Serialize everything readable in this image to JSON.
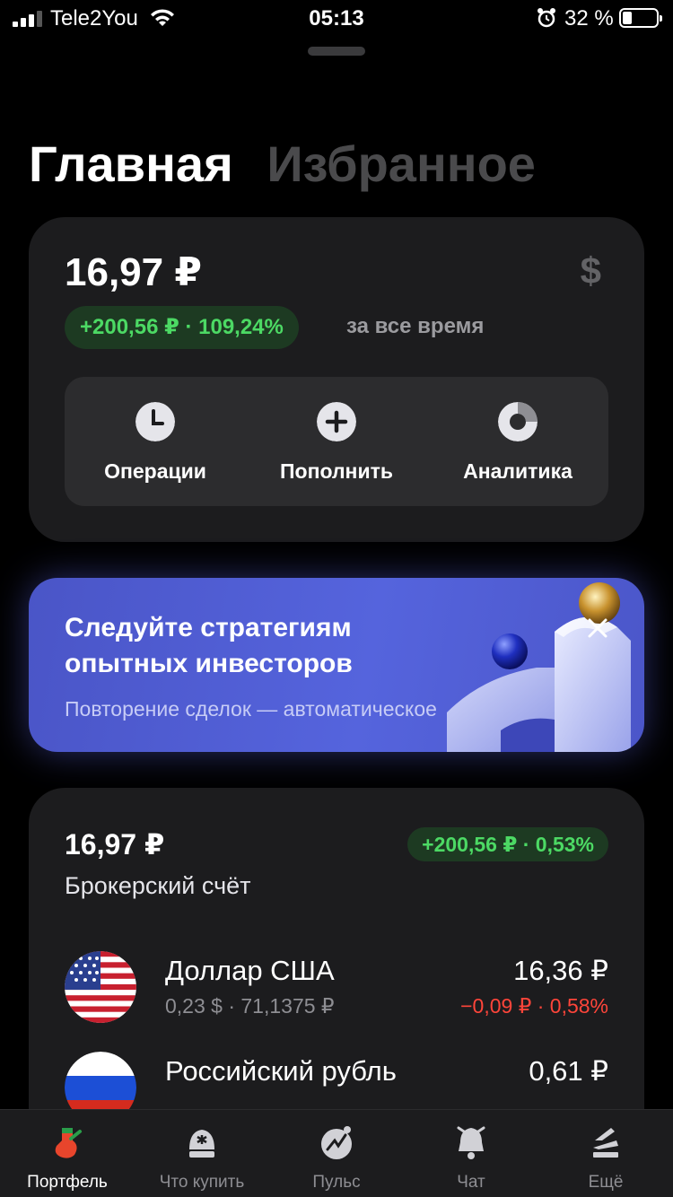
{
  "status_bar": {
    "carrier": "Tele2You",
    "time": "05:13",
    "battery_percent": "32 %"
  },
  "tabs": [
    {
      "label": "Главная",
      "active": true
    },
    {
      "label": "Избранное",
      "active": false
    }
  ],
  "portfolio": {
    "total": "16,97 ₽",
    "currency_icon": "dollar-icon",
    "gain": "+200,56 ₽ · 109,24%",
    "period": "за все время",
    "actions": [
      {
        "label": "Операции",
        "icon": "clock-icon"
      },
      {
        "label": "Пополнить",
        "icon": "plus-icon"
      },
      {
        "label": "Аналитика",
        "icon": "pie-chart-icon"
      }
    ]
  },
  "banner": {
    "title": "Следуйте стратегиям опытных инвесторов",
    "subtitle": "Повторение сделок — автоматическое"
  },
  "account": {
    "total": "16,97 ₽",
    "gain": "+200,56 ₽ · 0,53%",
    "name": "Брокерский счёт",
    "holdings": [
      {
        "name": "Доллар США",
        "sub": "0,23 $ · 71,1375 ₽",
        "value": "16,36 ₽",
        "change": "−0,09 ₽ · 0,58%",
        "flag": "us-flag"
      },
      {
        "name": "Российский рубль",
        "sub": "",
        "value": "0,61 ₽",
        "change": "",
        "flag": "ru-flag"
      }
    ]
  },
  "tab_bar": [
    {
      "label": "Портфель",
      "icon": "portfolio-icon",
      "active": true
    },
    {
      "label": "Что купить",
      "icon": "what-to-buy-icon",
      "active": false
    },
    {
      "label": "Пульс",
      "icon": "pulse-icon",
      "active": false
    },
    {
      "label": "Чат",
      "icon": "chat-bell-icon",
      "active": false
    },
    {
      "label": "Ещё",
      "icon": "more-icon",
      "active": false
    }
  ],
  "colors": {
    "background": "#000000",
    "card": "#1c1c1e",
    "positive": "#4cd964",
    "negative": "#ff453a",
    "banner": "#5564dd",
    "active_tab_icon": "#e8452c"
  }
}
